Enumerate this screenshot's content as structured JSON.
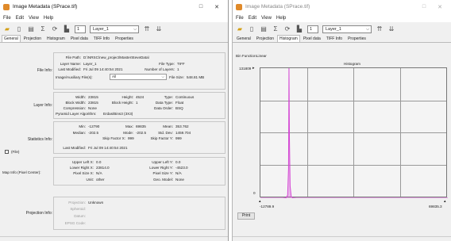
{
  "left": {
    "title": "Image Metadata (SPrace.tif)",
    "controls": {
      "minimize": "□",
      "close": "✕"
    },
    "menu": [
      "File",
      "Edit",
      "View",
      "Help"
    ],
    "toolbar": {
      "layer_num": "1",
      "layer": "Layer_1"
    },
    "tabs": [
      "General",
      "Projection",
      "Histogram",
      "Pixel data",
      "TIFF Info",
      "Properties"
    ],
    "active_tab": "General",
    "file_info": {
      "label": "File Info:",
      "file_path_label": "File Path:",
      "file_path": "D:\\NRSC\\new_project\\MasterSteveData\\",
      "layer_name_label": "Layer Name:",
      "layer_name": "Layer_1",
      "file_type_label": "File Type:",
      "file_type": "TIFF",
      "last_modified_label": "Last Modified:",
      "last_modified": "Fri Jul 09 14:40:54 2021",
      "num_layers_label": "Number of Layers:",
      "num_layers": "1",
      "aux_label": "Image/Auxiliary File(s):",
      "aux_value": "All",
      "file_size_label": "File Size:",
      "file_size": "548.81 MB"
    },
    "layer_info": {
      "label": "Layer Info:",
      "width_label": "Width:",
      "width": "23815",
      "height_label": "Height:",
      "height": "4524",
      "type_label": "Type:",
      "type": "Continuous",
      "block_width_label": "Block Width:",
      "block_width": "23815",
      "block_height_label": "Block Height:",
      "block_height": "1",
      "data_type_label": "Data Type:",
      "data_type": "Float",
      "compression_label": "Compression:",
      "compression": "None",
      "data_order_label": "Data Order:",
      "data_order": "BSQ",
      "pyramid_label": "Pyramid Layer Algorithm:",
      "pyramid": "Erdas/Bins3 (3X3)"
    },
    "stats_info": {
      "label": "Statistics Info:",
      "min_label": "Min:",
      "min": "-12790",
      "max_label": "Max:",
      "max": "69835",
      "mean_label": "Mean:",
      "mean": "353.762",
      "median_label": "Median:",
      "median": "-202.5",
      "mode_label": "Mode:",
      "mode": "-202.5",
      "stddev_label": "Std. Dev:",
      "stddev": "1459.704",
      "skipx_label": "Skip Factor X:",
      "skipx": "999",
      "skipy_label": "Skip Factor Y:",
      "skipy": "999",
      "file_label": "(File)",
      "last_modified_label": "Last Modified:",
      "last_modified": "Fri Jul 09 14:40:54 2021"
    },
    "map_info": {
      "label": "Map Info (Pixel Center):",
      "upper_left_x_label": "Upper Left X:",
      "upper_left_x": "0.0",
      "upper_left_y_label": "Upper Left Y:",
      "upper_left_y": "0.0",
      "lower_right_x_label": "Lower Right X:",
      "lower_right_x": "23814.0",
      "lower_right_y_label": "Lower Right Y:",
      "lower_right_y": "-4523.0",
      "pixel_size_x_label": "Pixel Size X:",
      "pixel_size_x": "N/A",
      "pixel_size_y_label": "Pixel Size Y:",
      "pixel_size_y": "N/A",
      "unit_label": "Unit:",
      "unit": "other",
      "geo_model_label": "Geo. Model:",
      "geo_model": "None"
    },
    "projection_info": {
      "label": "Projection Info:",
      "projection_label": "Projection:",
      "projection": "Unknown",
      "spheroid_label": "Spheroid:",
      "datum_label": "Datum:",
      "epsg_label": "EPSG Code:"
    }
  },
  "right": {
    "title": "Image Metadata (SPrace.tif)",
    "controls": {
      "minimize": "□",
      "close": "✕"
    },
    "menu": [
      "File",
      "Edit",
      "View",
      "Help"
    ],
    "toolbar": {
      "layer_num": "1",
      "layer": "Layer_1"
    },
    "tabs": [
      "General",
      "Projection",
      "Histogram",
      "Pixel data",
      "TIFF Info",
      "Properties"
    ],
    "active_tab": "Histogram",
    "bin_function_label": "Bin Function:",
    "bin_function": "Linear",
    "print_label": "Print",
    "chart_data": {
      "type": "area",
      "title": "Histogram",
      "xlabel": "",
      "ylabel": "",
      "xlim": [
        -12789.9,
        69835.3
      ],
      "ylim": [
        0,
        131809
      ],
      "x_tick_labels": [
        "-12789.9",
        "69835.3"
      ],
      "y_tick_labels": [
        "0",
        "131809"
      ],
      "series": [
        {
          "color": "#d447d4",
          "x": [
            -12789.9,
            -7000,
            -3000,
            -1500,
            -800,
            -400,
            -202.5,
            0,
            300,
            800,
            1500,
            3000,
            8000,
            69835.3
          ],
          "values": [
            0,
            0,
            0,
            400,
            3000,
            30000,
            131809,
            60000,
            12000,
            1500,
            300,
            0,
            0,
            0
          ]
        }
      ],
      "grid": true,
      "legend": "none"
    }
  }
}
